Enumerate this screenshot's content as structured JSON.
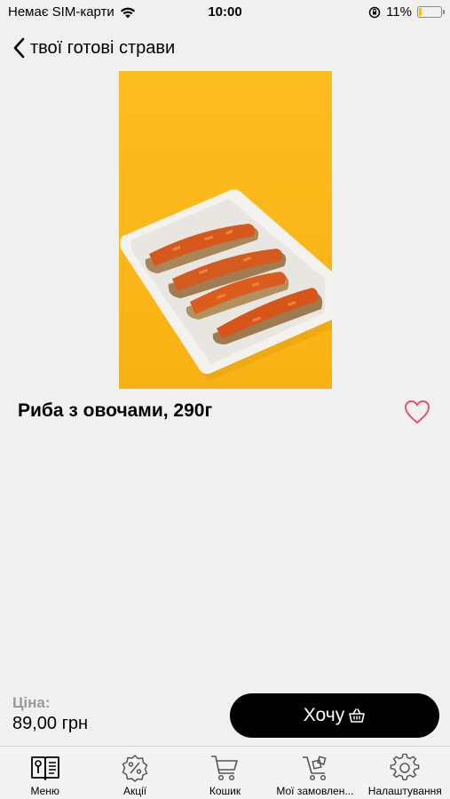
{
  "status_bar": {
    "carrier": "Немає SIM-карти",
    "time": "10:00",
    "battery_percent": "11%",
    "battery_level": 0.11,
    "icons": [
      "wifi-icon",
      "orientation-lock-icon",
      "battery-icon"
    ]
  },
  "header": {
    "back_icon": "chevron-left-icon",
    "title": "твої готові страви"
  },
  "product": {
    "name": "Риба з овочами, 290г",
    "favorite_icon": "heart-outline-icon",
    "price_label": "Ціна:",
    "price": "89,00 грн",
    "buy_label": "Хочу",
    "buy_icon": "basket-icon"
  },
  "tabbar": {
    "items": [
      {
        "label": "Меню",
        "icon": "menu-book-icon"
      },
      {
        "label": "Акції",
        "icon": "discount-icon"
      },
      {
        "label": "Кошик",
        "icon": "cart-icon"
      },
      {
        "label": "Мої замовлен...",
        "icon": "orders-cart-icon"
      },
      {
        "label": "Налаштування",
        "icon": "gear-icon"
      }
    ]
  },
  "colors": {
    "background": "#f0f0f0",
    "photo_background": "#fbb81a",
    "button": "#000000",
    "heart": "#e0546e",
    "battery": "#f2c200",
    "muted_text": "#9a9a9a"
  }
}
